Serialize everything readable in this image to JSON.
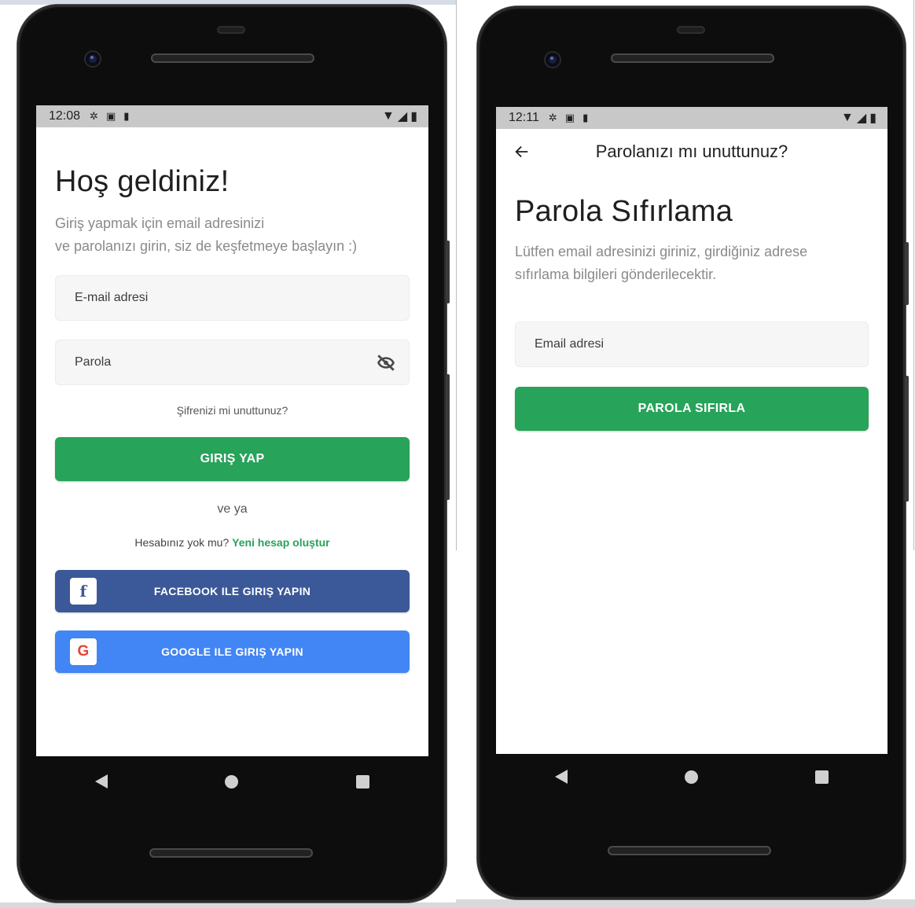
{
  "colors": {
    "primary_green": "#27a35a",
    "facebook_blue": "#3b5998",
    "google_blue": "#4285f4",
    "link_green": "#27a35a"
  },
  "login_screen": {
    "status": {
      "time": "12:08",
      "icons": [
        "settings-icon",
        "a-icon",
        "sd-card-icon"
      ],
      "right_icons": [
        "wifi-icon",
        "signal-icon",
        "battery-icon"
      ]
    },
    "title": "Hoş geldiniz!",
    "subtitle_line1": "Giriş yapmak için email adresinizi",
    "subtitle_line2": "ve parolanızı girin, siz de keşfetmeye başlayın :)",
    "email_placeholder": "E-mail adresi",
    "password_placeholder": "Parola",
    "forgot_link": "Şifrenizi mi unuttunuz?",
    "login_button": "GIRIŞ YAP",
    "or_text": "ve ya",
    "no_account_text": "Hesabınız yok mu?",
    "create_account_link": "Yeni hesap oluştur",
    "facebook_button": "FACEBOOK ILE GIRIŞ YAPIN",
    "google_button": "GOOGLE ILE GIRIŞ YAPIN"
  },
  "reset_screen": {
    "status": {
      "time": "12:11",
      "icons": [
        "settings-icon",
        "a-icon",
        "sd-card-icon"
      ],
      "right_icons": [
        "wifi-icon",
        "signal-icon",
        "battery-icon"
      ]
    },
    "appbar_title": "Parolanızı mı unuttunuz?",
    "title": "Parola Sıfırlama",
    "subtitle_line1": "Lütfen email adresinizi giriniz, girdiğiniz adrese",
    "subtitle_line2": "sıfırlama bilgileri gönderilecektir.",
    "email_placeholder": "Email adresi",
    "reset_button": "PAROLA SIFIRLA"
  }
}
